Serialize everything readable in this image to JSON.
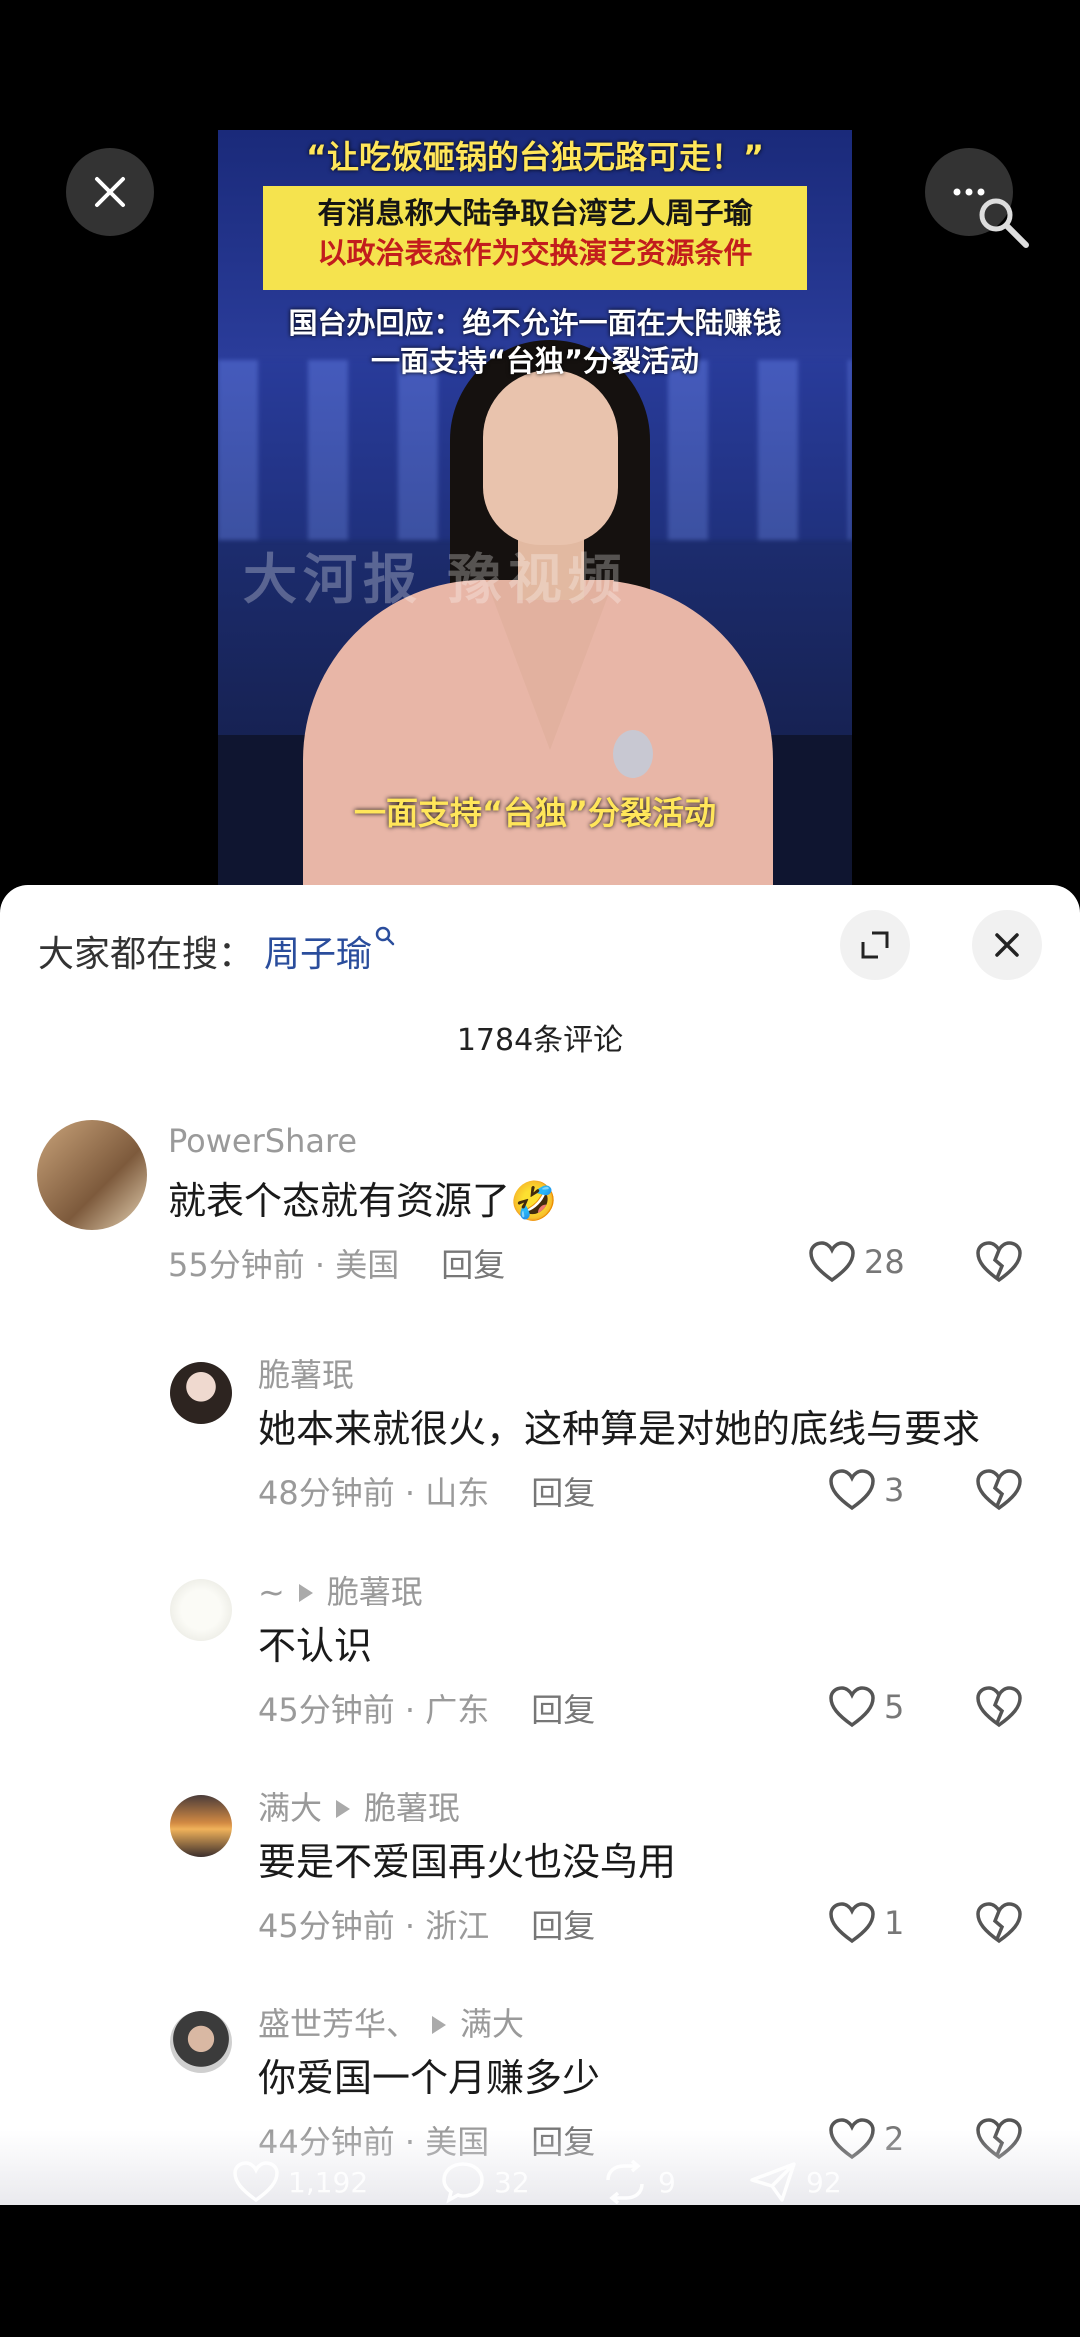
{
  "video": {
    "caption_top": "“让吃饭砸锅的台独无路可走！”",
    "caption_box_line1": "有消息称大陆争取台湾艺人周子瑜",
    "caption_box_line2": "以政治表态作为交换演艺资源条件",
    "caption_mid_line1": "国台办回应：绝不允许一面在大陆赚钱",
    "caption_mid_line2": "一面支持“台独”分裂活动",
    "subtitle": "一面支持“台独”分裂活动",
    "watermark": "大河报  豫视频"
  },
  "topbar": {
    "close_icon": "close-icon",
    "more_icon": "more-icon"
  },
  "sheet": {
    "hot_search_label": "大家都在搜：",
    "hot_search_keyword": "周子瑜",
    "comment_count": "1784条评论"
  },
  "comments": [
    {
      "user": "PowerShare",
      "reply_to": "",
      "text": "就表个态就有资源了🤣",
      "time": "55分钟前 · 美国",
      "reply": "回复",
      "likes": "28"
    },
    {
      "user": "脆薯珉",
      "reply_to": "",
      "text": "她本来就很火，这种算是对她的底线与要求",
      "time": "48分钟前 · 山东",
      "reply": "回复",
      "likes": "3"
    },
    {
      "user": "~",
      "reply_to": "脆薯珉",
      "text": "不认识",
      "time": "45分钟前 · 广东",
      "reply": "回复",
      "likes": "5"
    },
    {
      "user": "满大",
      "reply_to": "脆薯珉",
      "text": "要是不爱国再火也没鸟用",
      "time": "45分钟前 · 浙江",
      "reply": "回复",
      "likes": "1"
    },
    {
      "user": "盛世芳华、",
      "reply_to": "满大",
      "text": "你爱国一个月赚多少",
      "time": "44分钟前 · 美国",
      "reply": "回复",
      "likes": "2"
    }
  ],
  "bottom_stats": {
    "likes": "1,192",
    "comments": "32",
    "reposts": "9",
    "shares": "92"
  }
}
